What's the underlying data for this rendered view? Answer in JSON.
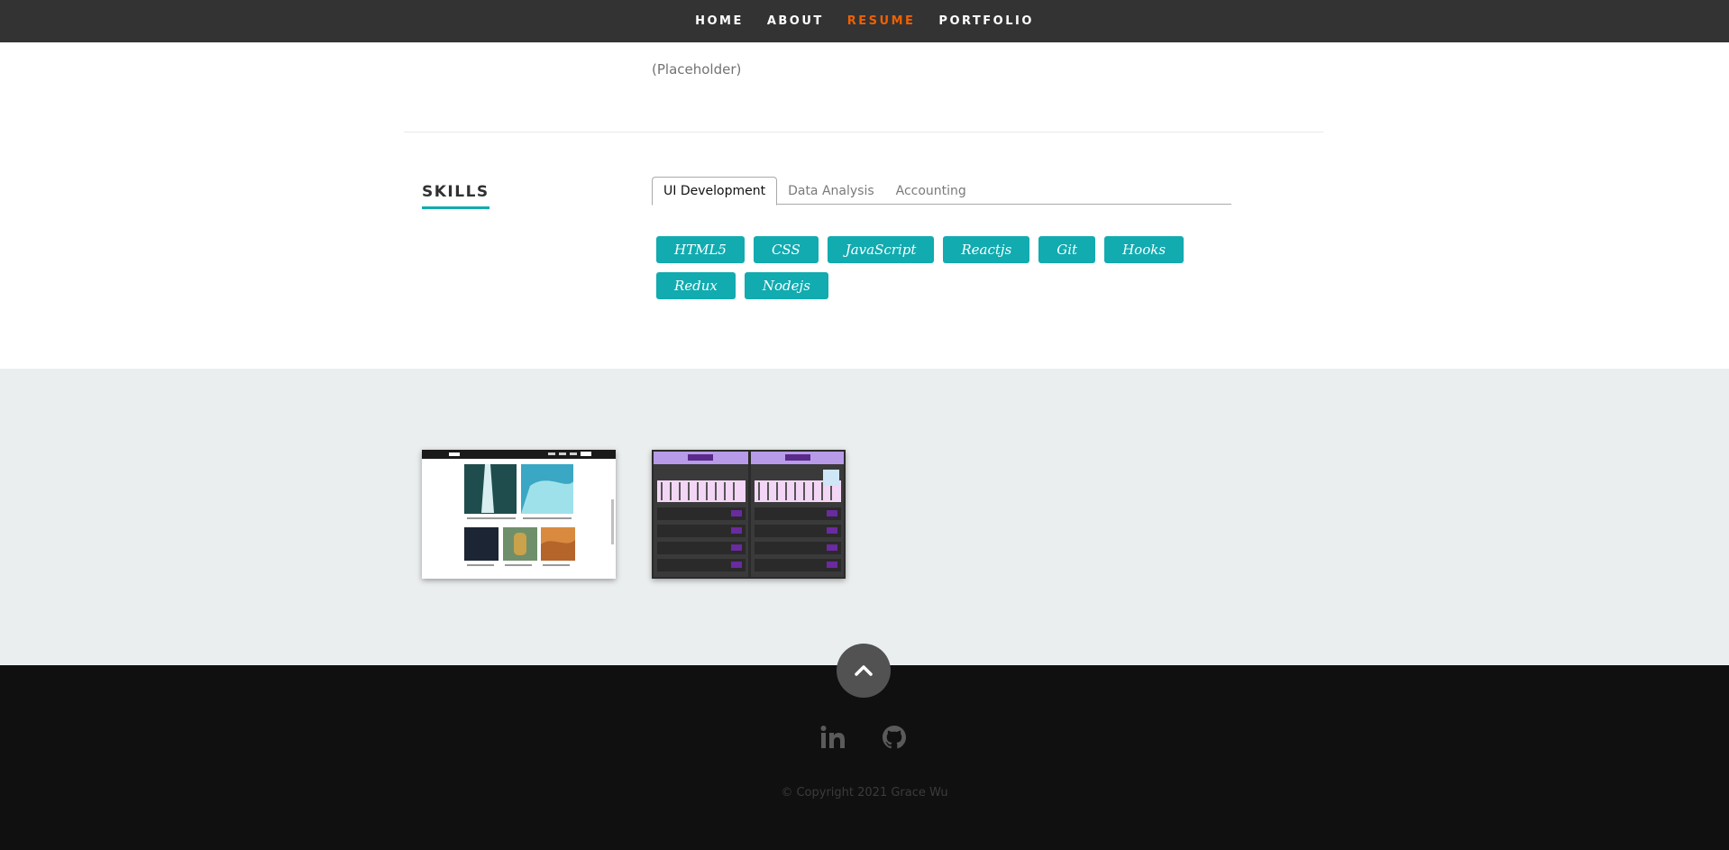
{
  "nav": {
    "items": [
      {
        "label": "HOME"
      },
      {
        "label": "ABOUT"
      },
      {
        "label": "RESUME",
        "active": true
      },
      {
        "label": "PORTFOLIO"
      }
    ],
    "active_color": "#F06000"
  },
  "resume": {
    "placeholder_text": "(Placeholder)"
  },
  "skills": {
    "title": "SKILLS",
    "tabs": [
      {
        "label": "UI Development",
        "selected": true
      },
      {
        "label": "Data Analysis"
      },
      {
        "label": "Accounting"
      }
    ],
    "chips": [
      "HTML5",
      "CSS",
      "JavaScript",
      "Reactjs",
      "Git",
      "Hooks",
      "Redux",
      "Nodejs"
    ],
    "accent_color": "#11ABB0"
  },
  "portfolio": {
    "projects": [
      {
        "icon": "gallery-screenshot-icon"
      },
      {
        "icon": "app-screenshot-icon"
      }
    ],
    "background": "#EBEEEE"
  },
  "footer": {
    "go_top_icon": "chevron-up-icon",
    "social": [
      {
        "icon": "linkedin-icon"
      },
      {
        "icon": "github-icon"
      }
    ],
    "copyright": "© Copyright 2021 Grace Wu",
    "background": "#101010"
  }
}
